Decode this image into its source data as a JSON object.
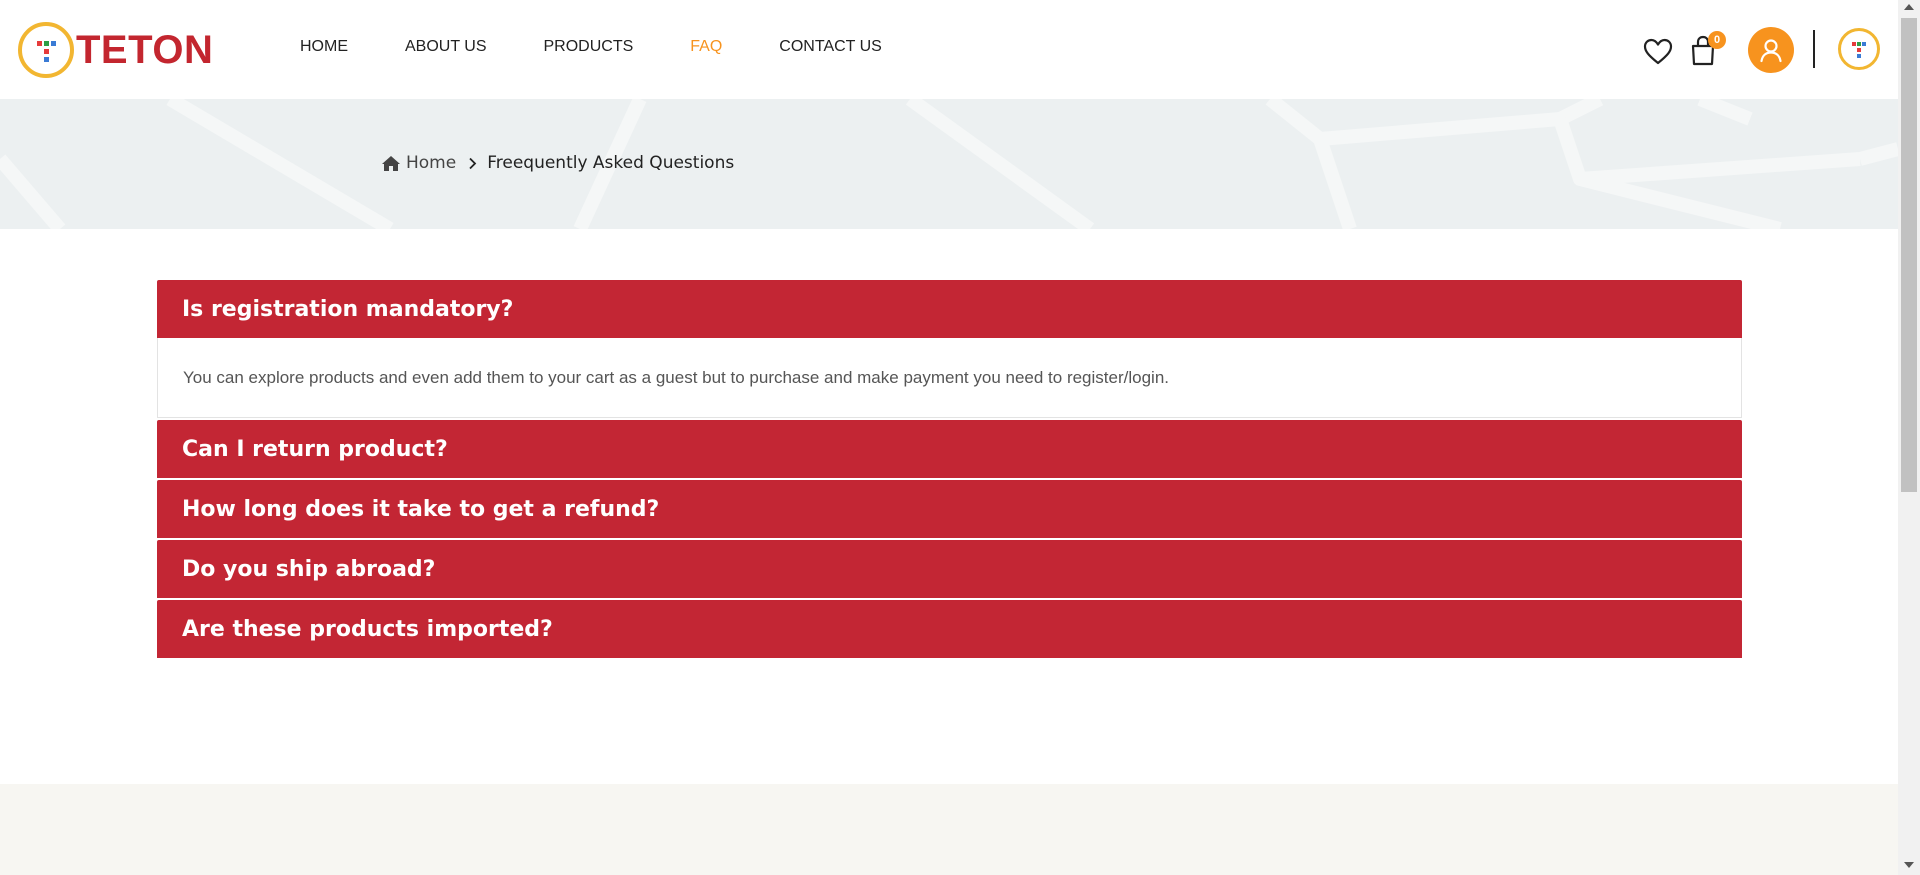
{
  "brand": {
    "name": "TETON",
    "primary_color": "#c3262f",
    "accent_color": "#f7931e",
    "ring_color": "#f2b631"
  },
  "nav": {
    "items": [
      {
        "label": "HOME",
        "active": false
      },
      {
        "label": "ABOUT US",
        "active": false
      },
      {
        "label": "PRODUCTS",
        "active": false
      },
      {
        "label": "FAQ",
        "active": true
      },
      {
        "label": "CONTACT US",
        "active": false
      }
    ]
  },
  "header_icons": {
    "wishlist": "heart-icon",
    "cart": "shopping-bag-icon",
    "cart_count": "0",
    "account": "user-icon",
    "profile": "teton-logo-icon"
  },
  "breadcrumb": {
    "home_label": "Home",
    "home_icon": "home-icon",
    "separator_icon": "chevron-right-icon",
    "current": "Freequently Asked Questions"
  },
  "faq": {
    "items": [
      {
        "question": "Is registration mandatory?",
        "answer": "You can explore products and even add them to your cart as a guest but to purchase and make payment you need to register/login.",
        "expanded": true
      },
      {
        "question": "Can I return product?",
        "answer": "",
        "expanded": false
      },
      {
        "question": "How long does it take to get a refund?",
        "answer": "",
        "expanded": false
      },
      {
        "question": "Do you ship abroad?",
        "answer": "",
        "expanded": false
      },
      {
        "question": "Are these products imported?",
        "answer": "",
        "expanded": false
      }
    ]
  }
}
